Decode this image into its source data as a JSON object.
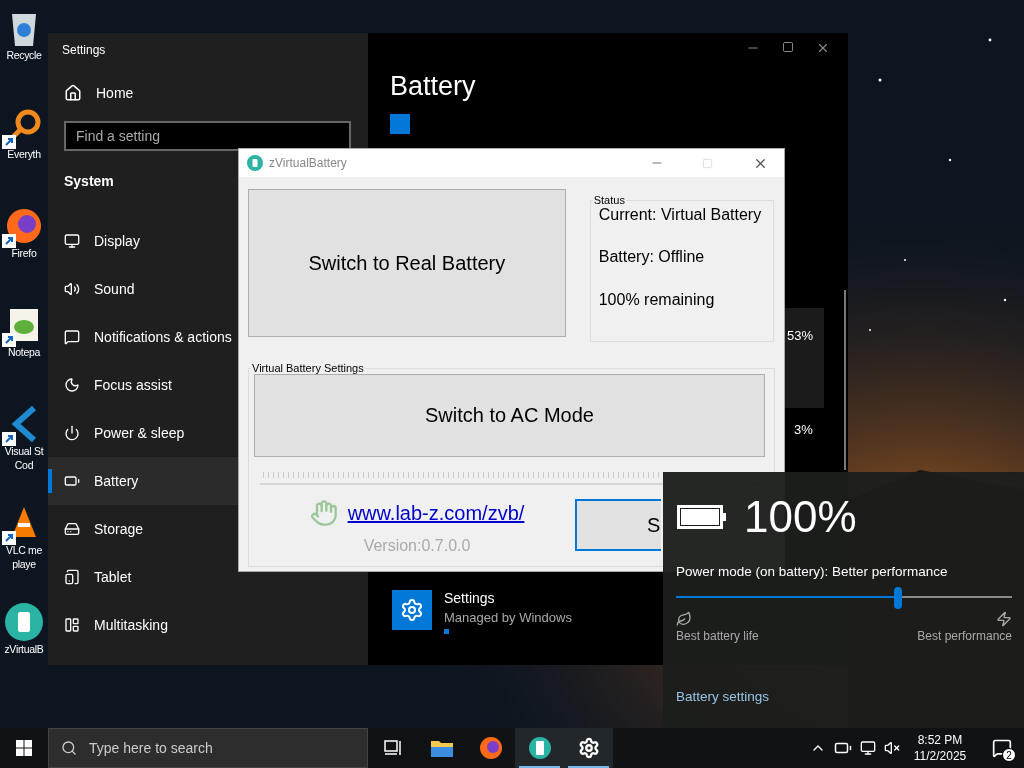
{
  "desktop_icons": [
    {
      "lines": [
        "Recycle"
      ],
      "shortcut": false
    },
    {
      "lines": [
        "Everyth"
      ],
      "shortcut": true
    },
    {
      "lines": [
        "Firefo"
      ],
      "shortcut": true
    },
    {
      "lines": [
        "Notepa"
      ],
      "shortcut": true
    },
    {
      "lines": [
        "Visual St",
        "Cod"
      ],
      "shortcut": true
    },
    {
      "lines": [
        "VLC me",
        "playe"
      ],
      "shortcut": true
    },
    {
      "lines": [
        "zVirtualB"
      ],
      "shortcut": false
    }
  ],
  "settings_window": {
    "title": "Settings",
    "sidebar": {
      "home": "Home",
      "search": {
        "placeholder": "Find a setting"
      },
      "section": "System",
      "items": [
        {
          "label": "Display",
          "selected": false
        },
        {
          "label": "Sound",
          "selected": false
        },
        {
          "label": "Notifications & actions",
          "selected": false
        },
        {
          "label": "Focus assist",
          "selected": false
        },
        {
          "label": "Power & sleep",
          "selected": false
        },
        {
          "label": "Battery",
          "selected": true
        },
        {
          "label": "Storage",
          "selected": false
        },
        {
          "label": "Tablet",
          "selected": false
        },
        {
          "label": "Multitasking",
          "selected": false
        }
      ]
    },
    "page": {
      "heading": "Battery",
      "checkbox": {
        "checked": true
      },
      "readings": [
        "53%",
        "3%"
      ],
      "app_row": {
        "title": "Settings",
        "subtitle": "Managed by Windows"
      }
    }
  },
  "zvb_window": {
    "title": "zVirtualBattery",
    "real_button": "Switch to Real Battery",
    "status": {
      "label": "Status",
      "lines": [
        "Current: Virtual Battery",
        "Battery: Offline",
        "100% remaining"
      ]
    },
    "settings_group": {
      "label": "Virtual Battery Settings",
      "ac_button": "Switch to AC Mode"
    },
    "link": "www.lab-z.com/zvb/",
    "version": "Version:0.7.0.0",
    "partial_button": "S"
  },
  "flyout": {
    "percent": "100%",
    "mode_label": "Power mode (on battery): Better performance",
    "slider": {
      "level": 0.66
    },
    "left_label": "Best battery life",
    "right_label": "Best performance",
    "link": "Battery settings"
  },
  "taskbar": {
    "search": {
      "placeholder": "Type here to search"
    },
    "apps": [
      {
        "running": false
      },
      {
        "running": false
      },
      {
        "running": false
      },
      {
        "running": true
      },
      {
        "running": true
      }
    ],
    "time": "8:52 PM",
    "date": "11/2/2025",
    "notifications": "2"
  }
}
